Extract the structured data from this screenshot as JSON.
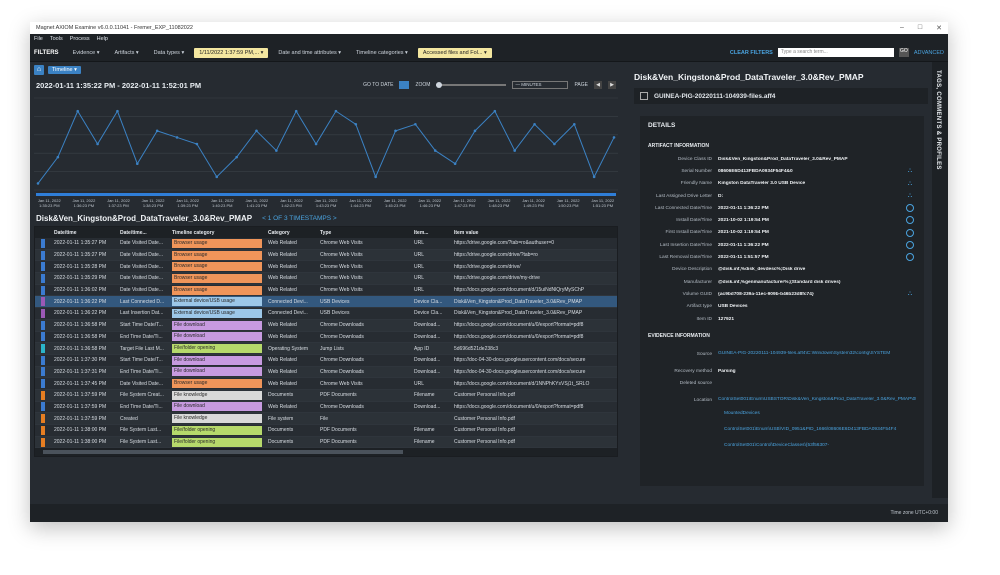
{
  "window": {
    "title": "Magnet AXIOM Examine v6.0.0.11041 - Fremer_EXP_11082022",
    "controls": [
      "–",
      "□",
      "✕"
    ]
  },
  "menu": [
    "File",
    "Tools",
    "Process",
    "Help"
  ],
  "filters": {
    "title": "FILTERS",
    "buttons": [
      "Evidence ▾",
      "Artifacts ▾",
      "Data types ▾",
      "1/11/2022 1:37:59 PM,... ▾",
      "Date and time attributes ▾",
      "Timeline categories ▾",
      "Accessed files and Fol... ▾"
    ],
    "clear": "CLEAR FILTERS",
    "search_placeholder": "Type a search term...",
    "search_btn": "GO",
    "advanced": "ADVANCED"
  },
  "timeline": {
    "view_label": "Timeline ▾",
    "range": "2022-01-11 1:35:22 PM  -  2022-01-11 1:52:01 PM",
    "goto": "GO TO DATE",
    "zoom": "ZOOM",
    "minutes": "— MINUTES",
    "page": "PAGE",
    "ticks": [
      "Jan 11, 2022 1:35:23 PM",
      "Jan 11, 2022 1:36:23 PM",
      "Jan 11, 2022 1:37:23 PM",
      "Jan 11, 2022 1:38:23 PM",
      "Jan 11, 2022 1:39:23 PM",
      "Jan 11, 2022 1:40:23 PM",
      "Jan 11, 2022 1:41:23 PM",
      "Jan 11, 2022 1:42:23 PM",
      "Jan 11, 2022 1:43:23 PM",
      "Jan 11, 2022 1:44:23 PM",
      "Jan 11, 2022 1:45:23 PM",
      "Jan 11, 2022 1:46:23 PM",
      "Jan 11, 2022 1:47:23 PM",
      "Jan 11, 2022 1:48:23 PM",
      "Jan 11, 2022 1:49:23 PM",
      "Jan 11, 2022 1:50:23 PM",
      "Jan 11, 2022 1:51:23 PM"
    ]
  },
  "section": {
    "name": "Disk&Ven_Kingston&Prod_DataTraveler_3.0&Rev_PMAP",
    "count": "< 1 OF 3 TIMESTAMPS >"
  },
  "columns": [
    "Date/time",
    "Date/time...",
    "Timeline category",
    "Category",
    "Type",
    "Item...",
    "Item value"
  ],
  "rows": [
    {
      "strip": "#3b7bd0",
      "dt": "2022-01-11 1:35:27 PM",
      "dta": "Date Visited Date...",
      "cat": "Browser usage",
      "catcolor": "#f0955a",
      "category": "Web Related",
      "type": "Chrome Web Visits",
      "item": "URL",
      "value": "https://drive.google.com/?tab=ro&authuser=0"
    },
    {
      "strip": "#3b7bd0",
      "dt": "2022-01-11 1:35:27 PM",
      "dta": "Date Visited Date...",
      "cat": "Browser usage",
      "catcolor": "#f0955a",
      "category": "Web Related",
      "type": "Chrome Web Visits",
      "item": "URL",
      "value": "https://drive.google.com/drive/?tab=ro"
    },
    {
      "strip": "#3b7bd0",
      "dt": "2022-01-11 1:35:28 PM",
      "dta": "Date Visited Date...",
      "cat": "Browser usage",
      "catcolor": "#f0955a",
      "category": "Web Related",
      "type": "Chrome Web Visits",
      "item": "URL",
      "value": "https://drive.google.com/drive/"
    },
    {
      "strip": "#3b7bd0",
      "dt": "2022-01-11 1:35:29 PM",
      "dta": "Date Visited Date...",
      "cat": "Browser usage",
      "catcolor": "#f0955a",
      "category": "Web Related",
      "type": "Chrome Web Visits",
      "item": "URL",
      "value": "https://drive.google.com/drive/my-drive"
    },
    {
      "strip": "#3b7bd0",
      "dt": "2022-01-11 1:36:02 PM",
      "dta": "Date Visited Date...",
      "cat": "Browser usage",
      "catcolor": "#f0955a",
      "category": "Web Related",
      "type": "Chrome Web Visits",
      "item": "URL",
      "value": "https://docs.google.com/document/d/15uiNdNlQryMySChP"
    },
    {
      "strip": "#9b59b6",
      "dt": "2022-01-11 1:36:22 PM",
      "dta": "Last Connected D...",
      "cat": "External device/USB usage",
      "catcolor": "#9cc7e8",
      "category": "Connected Devi...",
      "type": "USB Devices",
      "item": "Device Cla...",
      "value": "Disk&Ven_Kingston&Prod_DataTraveler_3.0&Rev_PMAP",
      "sel": true
    },
    {
      "strip": "#9b59b6",
      "dt": "2022-01-11 1:36:22 PM",
      "dta": "Last Insertion Dat...",
      "cat": "External device/USB usage",
      "catcolor": "#9cc7e8",
      "category": "Connected Devi...",
      "type": "USB Devices",
      "item": "Device Cla...",
      "value": "Disk&Ven_Kingston&Prod_DataTraveler_3.0&Rev_PMAP"
    },
    {
      "strip": "#3b7bd0",
      "dt": "2022-01-11 1:36:58 PM",
      "dta": "Start Time Date/T...",
      "cat": "File download",
      "catcolor": "#c79ae0",
      "category": "Web Related",
      "type": "Chrome Downloads",
      "item": "Download...",
      "value": "https://docs.google.com/document/u/0/export?format=pdf8"
    },
    {
      "strip": "#3b7bd0",
      "dt": "2022-01-11 1:36:58 PM",
      "dta": "End Time Date/Ti...",
      "cat": "File download",
      "catcolor": "#c79ae0",
      "category": "Web Related",
      "type": "Chrome Downloads",
      "item": "Download...",
      "value": "https://docs.google.com/document/u/0/export?format=pdf8"
    },
    {
      "strip": "#2bb5c9",
      "dt": "2022-01-11 1:36:58 PM",
      "dta": "Target File Last M...",
      "cat": "File/folder opening",
      "catcolor": "#b6d96b",
      "category": "Operating System",
      "type": "Jump Lists",
      "item": "App ID",
      "value": "5d696d521de238c3"
    },
    {
      "strip": "#3b7bd0",
      "dt": "2022-01-11 1:37:30 PM",
      "dta": "Start Time Date/T...",
      "cat": "File download",
      "catcolor": "#c79ae0",
      "category": "Web Related",
      "type": "Chrome Downloads",
      "item": "Download...",
      "value": "https://doc-04-30-docs.googleusercontent.com/docs/secure"
    },
    {
      "strip": "#3b7bd0",
      "dt": "2022-01-11 1:37:31 PM",
      "dta": "End Time Date/Ti...",
      "cat": "File download",
      "catcolor": "#c79ae0",
      "category": "Web Related",
      "type": "Chrome Downloads",
      "item": "Download...",
      "value": "https://doc-04-30-docs.googleusercontent.com/docs/secure"
    },
    {
      "strip": "#3b7bd0",
      "dt": "2022-01-11 1:37:45 PM",
      "dta": "Date Visited Date...",
      "cat": "Browser usage",
      "catcolor": "#f0955a",
      "category": "Web Related",
      "type": "Chrome Web Visits",
      "item": "URL",
      "value": "https://docs.google.com/document/d/1NNPhKYsVSj1t_SRLO"
    },
    {
      "strip": "#e67e22",
      "dt": "2022-01-11 1:37:59 PM",
      "dta": "File System Creat...",
      "cat": "File knowledge",
      "catcolor": "#d9d9d9",
      "category": "Documents",
      "type": "PDF Documents",
      "item": "Filename",
      "value": "Customer Personal Info.pdf"
    },
    {
      "strip": "#3b7bd0",
      "dt": "2022-01-11 1:37:59 PM",
      "dta": "End Time Date/Ti...",
      "cat": "File download",
      "catcolor": "#c79ae0",
      "category": "Web Related",
      "type": "Chrome Downloads",
      "item": "Download...",
      "value": "https://docs.google.com/document/u/0/export?format=pdf8"
    },
    {
      "strip": "#e67e22",
      "dt": "2022-01-11 1:37:59 PM",
      "dta": "Created",
      "cat": "File knowledge",
      "catcolor": "#d9d9d9",
      "category": "File system",
      "type": "File",
      "item": "",
      "value": "Customer Personal Info.pdf"
    },
    {
      "strip": "#e67e22",
      "dt": "2022-01-11 1:38:00 PM",
      "dta": "File System Last...",
      "cat": "File/folder opening",
      "catcolor": "#b6d96b",
      "category": "Documents",
      "type": "PDF Documents",
      "item": "Filename",
      "value": "Customer Personal Info.pdf"
    },
    {
      "strip": "#e67e22",
      "dt": "2022-01-11 1:38:00 PM",
      "dta": "File System Last...",
      "cat": "File/folder opening",
      "catcolor": "#b6d96b",
      "category": "Documents",
      "type": "PDF Documents",
      "item": "Filename",
      "value": "Customer Personal Info.pdf"
    }
  ],
  "right": {
    "title": "Disk&Ven_Kingston&Prod_DataTraveler_3.0&Rev_PMAP",
    "source": "GUINEA-PIG-20220111-104939-files.aff4",
    "details_title": "DETAILS",
    "artifact_title": "ARTIFACT INFORMATION",
    "artifact": [
      {
        "k": "Device Class ID",
        "v": "Disk&Ven_Kingston&Prod_DataTraveler_3.0&Rev_PMAP",
        "icon": ""
      },
      {
        "k": "Serial Number",
        "v": "08606E6D413FBDA0934F54F4&0",
        "icon": "tree"
      },
      {
        "k": "Friendly Name",
        "v": "Kingston DataTraveler 3.0 USB Device",
        "icon": "tree"
      },
      {
        "k": "Last Assigned Drive Letter",
        "v": "D:",
        "icon": "tree"
      },
      {
        "k": "Last Connected Date/Time",
        "v": "2022-01-11 1:36:22 PM",
        "icon": "clock"
      },
      {
        "k": "Install Date/Time",
        "v": "2021-10-02 1:19:54 PM",
        "icon": "clock"
      },
      {
        "k": "First Install Date/Time",
        "v": "2021-10-02 1:19:54 PM",
        "icon": "clock"
      },
      {
        "k": "Last Insertion Date/Time",
        "v": "2022-01-11 1:36:22 PM",
        "icon": "clock"
      },
      {
        "k": "Last Removal Date/Time",
        "v": "2022-01-11 1:51:57 PM",
        "icon": "clock"
      },
      {
        "k": "Device Description",
        "v": "@disk.inf,%disk_devdesc%;Disk drive",
        "icon": ""
      },
      {
        "k": "Manufacturer",
        "v": "@disk.inf,%genmanufacturer%;(Standard disk drives)",
        "icon": ""
      },
      {
        "k": "Volume GUID",
        "v": "{ac9bd708-239a-11ec-909b-b46b23d8fc74}",
        "icon": "tree"
      },
      {
        "k": "Artifact type",
        "v": "USB Devices",
        "icon": ""
      },
      {
        "k": "Item ID",
        "v": "127921",
        "icon": ""
      }
    ],
    "evidence_title": "EVIDENCE INFORMATION",
    "evidence": [
      {
        "k": "Source",
        "v": "GUINEA-PIG-20220111-104939-files.aff4\\C:\\Windows\\System32\\config\\SYSTEM",
        "link": true
      },
      {
        "k": "Recovery method",
        "v": "Parsing",
        "link": false
      },
      {
        "k": "Deleted source",
        "v": "",
        "link": false
      },
      {
        "k": "Location",
        "v": "ControlSet001\\Enum\\USBSTOR\\Disk&Ven_Kingston&Prod_DataTraveler_3.0&Rev_PMAP\\08606E6D413FBDA0934F54F4&0",
        "link": true
      }
    ],
    "locations": [
      "MountedDevices",
      "ControlSet001\\Enum\\USB\\VID_0951&PID_1666\\08606E6D413FBDA0934F54F4",
      "ControlSet001\\Control\\DeviceClasses\\{53f56307-"
    ]
  },
  "side_tab": "TAGS, COMMENTS & PROFILES",
  "status": "Time zone   UTC+0:00",
  "chart_data": {
    "type": "line",
    "x": [
      "1:35:23 PM",
      "1:36:23 PM",
      "1:37:23 PM",
      "1:38:23 PM",
      "1:39:23 PM",
      "1:40:23 PM",
      "1:41:23 PM",
      "1:42:23 PM",
      "1:43:23 PM",
      "1:44:23 PM",
      "1:45:23 PM",
      "1:46:23 PM",
      "1:47:23 PM",
      "1:48:23 PM",
      "1:49:23 PM",
      "1:50:23 PM",
      "1:51:23 PM"
    ],
    "series": [
      {
        "values": [
          1,
          5,
          12,
          7,
          12,
          4,
          9,
          8,
          7,
          2,
          5,
          9,
          6,
          12,
          7,
          12,
          10,
          2,
          9,
          10,
          6,
          4,
          9,
          12,
          6,
          10,
          7,
          10,
          2,
          8
        ]
      }
    ],
    "ylim": [
      0,
      14
    ],
    "grid": true,
    "color": "#3b82c4"
  }
}
